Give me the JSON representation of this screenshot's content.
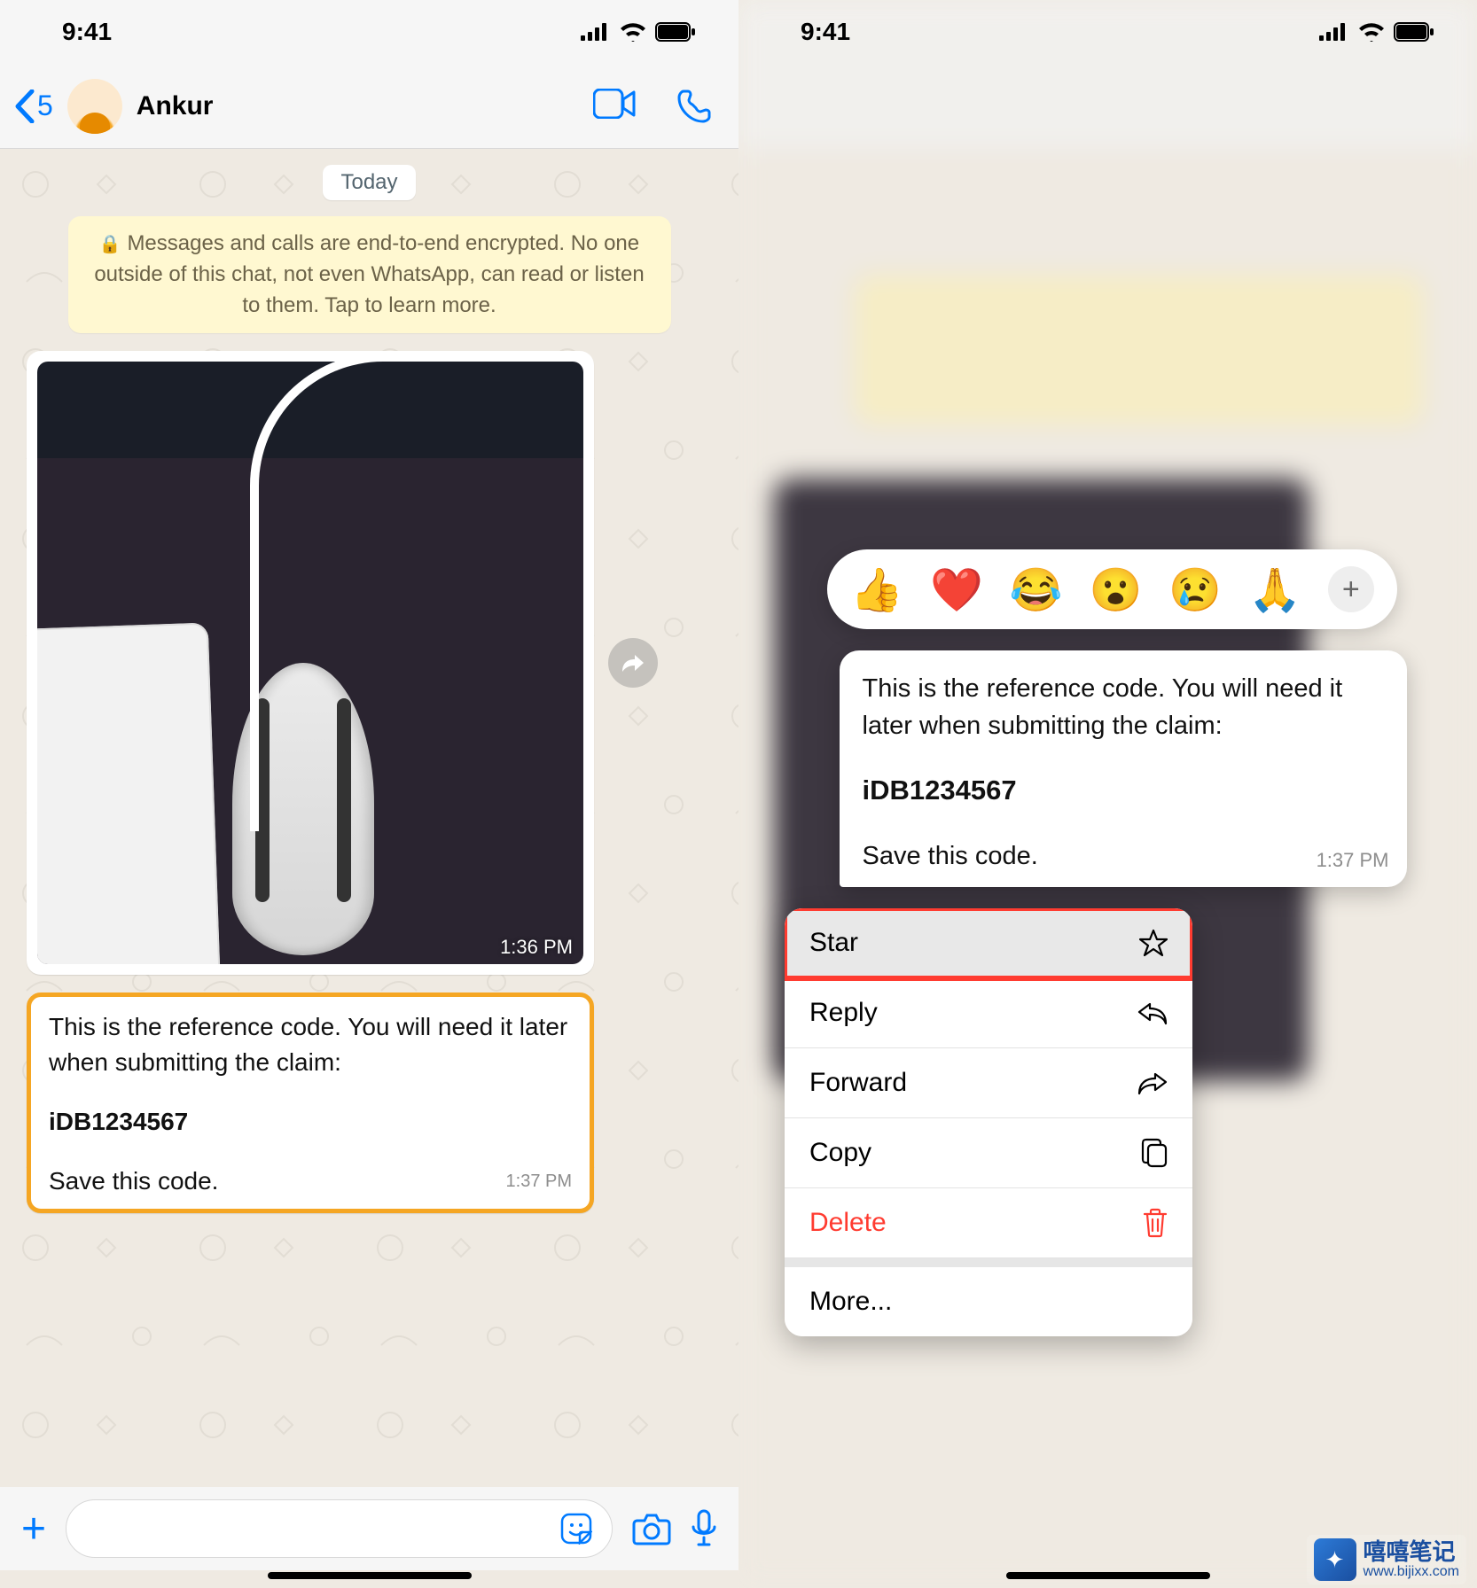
{
  "status": {
    "time": "9:41"
  },
  "chat": {
    "back_count": "5",
    "contact_name": "Ankur",
    "date_label": "Today",
    "e2e_notice": "Messages and calls are end-to-end encrypted. No one outside of this chat, not even WhatsApp, can read or listen to them. Tap to learn more.",
    "image_time": "1:36 PM",
    "message": {
      "line1": "This is the reference code. You will need it later when submitting the claim:",
      "code": "iDB1234567",
      "line2": "Save this code.",
      "time": "1:37 PM"
    }
  },
  "reactions": {
    "emojis": [
      "👍",
      "❤️",
      "😂",
      "😮",
      "😢",
      "🙏"
    ]
  },
  "menu": {
    "star": "Star",
    "reply": "Reply",
    "forward": "Forward",
    "copy": "Copy",
    "delete": "Delete",
    "more": "More..."
  },
  "watermark": {
    "title": "嘻嘻笔记",
    "url": "www.bijixx.com"
  }
}
